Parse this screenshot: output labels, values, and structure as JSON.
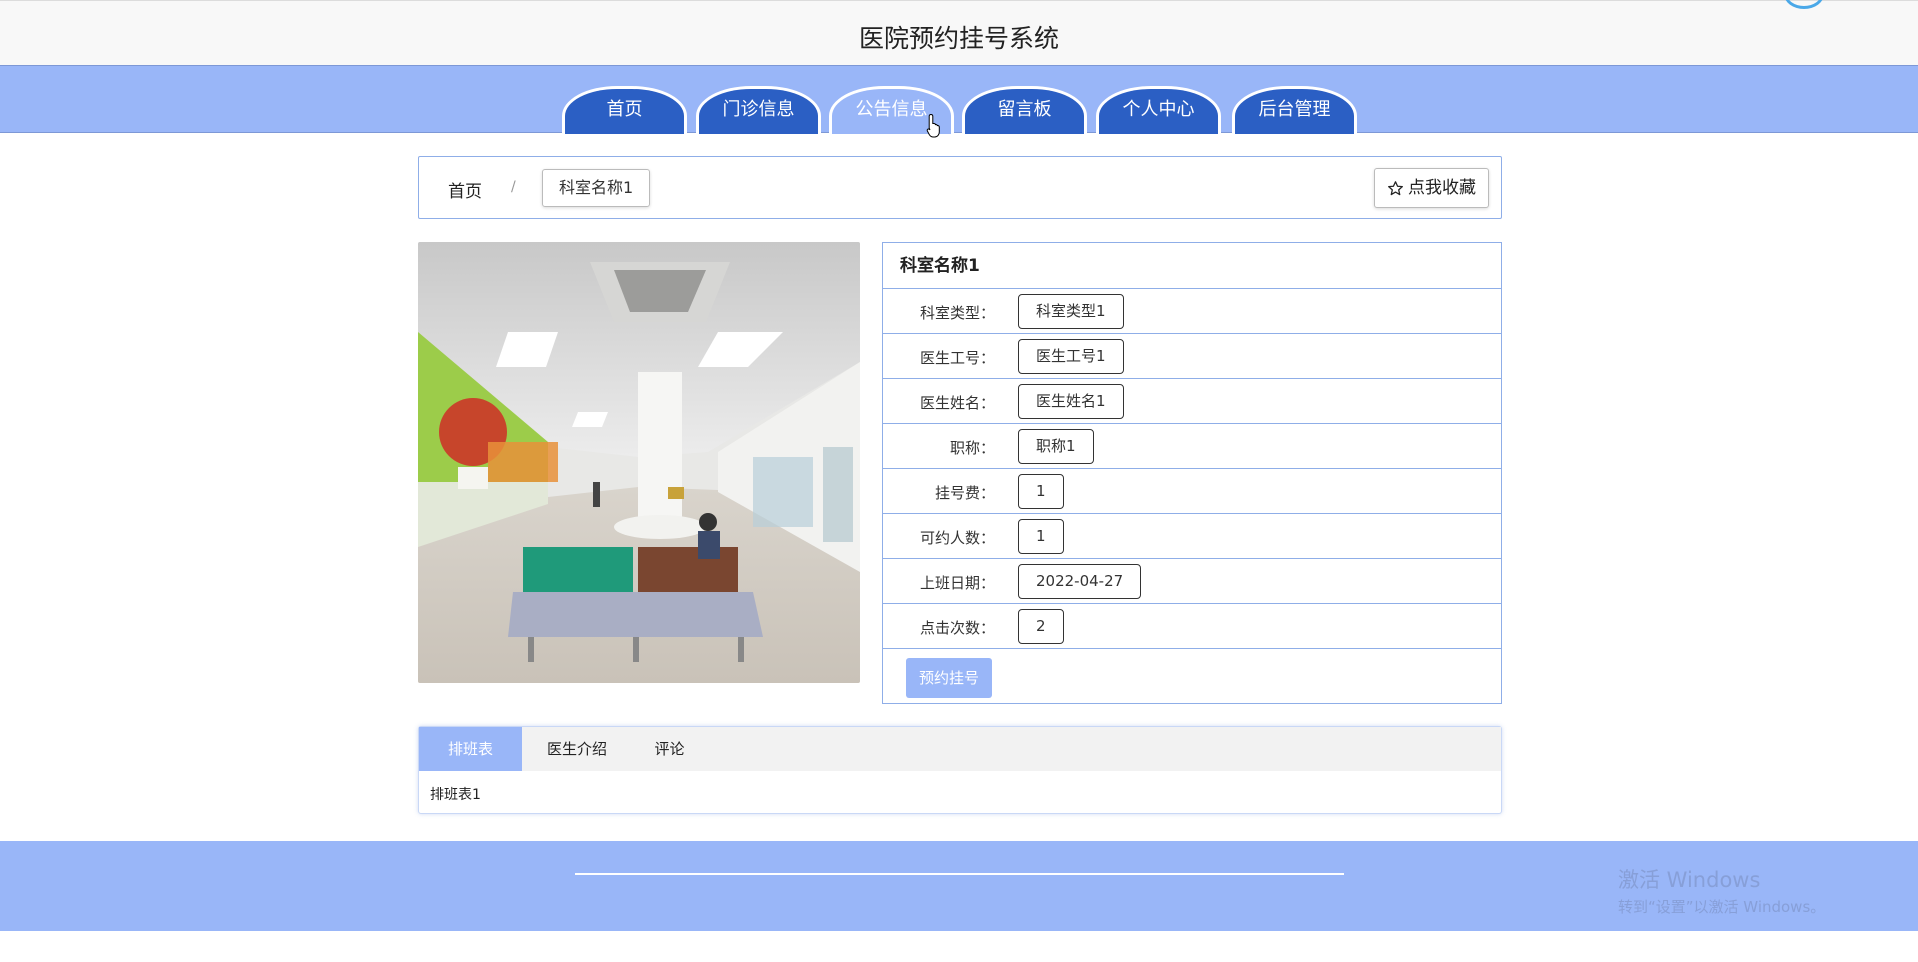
{
  "header": {
    "title": "医院预约挂号系统"
  },
  "nav": {
    "items": [
      {
        "label": "首页"
      },
      {
        "label": "门诊信息"
      },
      {
        "label": "公告信息"
      },
      {
        "label": "留言板"
      },
      {
        "label": "个人中心"
      },
      {
        "label": "后台管理"
      }
    ],
    "active_index": 2
  },
  "breadcrumb": {
    "home": "首页",
    "separator": "/",
    "current": "科室名称1",
    "favorite_label": "点我收藏",
    "favorite_icon": "star-outline-icon"
  },
  "detail": {
    "title": "科室名称1",
    "rows": [
      {
        "label": "科室类型：",
        "value": "科室类型1"
      },
      {
        "label": "医生工号：",
        "value": "医生工号1"
      },
      {
        "label": "医生姓名：",
        "value": "医生姓名1"
      },
      {
        "label": "职称：",
        "value": "职称1"
      },
      {
        "label": "挂号费：",
        "value": "1"
      },
      {
        "label": "可约人数：",
        "value": "1"
      },
      {
        "label": "上班日期：",
        "value": "2022-04-27"
      },
      {
        "label": "点击次数：",
        "value": "2"
      }
    ],
    "book_button": "预约挂号"
  },
  "tabs": {
    "items": [
      {
        "label": "排班表"
      },
      {
        "label": "医生介绍"
      },
      {
        "label": "评论"
      }
    ],
    "active_index": 0,
    "content": "排班表1"
  },
  "watermark": {
    "line1": "激活 Windows",
    "line2": "转到“设置”以激活 Windows。"
  },
  "colors": {
    "nav_bg": "#99b6f8",
    "nav_tab": "#2b5fc4",
    "border": "#8faee8"
  }
}
